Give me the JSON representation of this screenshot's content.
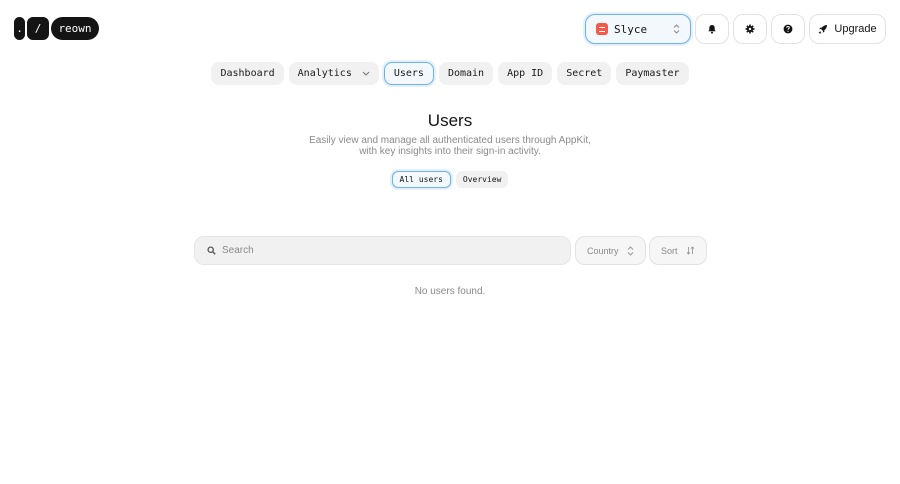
{
  "logo": {
    "part1": ".",
    "part2": "/",
    "part3": "reown"
  },
  "header": {
    "project": {
      "name": "Slyce",
      "accent": "#f25a4a"
    },
    "upgrade_label": "Upgrade",
    "icons": [
      "bell-icon",
      "gear-icon",
      "help-icon",
      "rocket-icon"
    ]
  },
  "tabs": [
    {
      "label": "Dashboard",
      "active": false
    },
    {
      "label": "Analytics",
      "active": false,
      "dropdown": true
    },
    {
      "label": "Users",
      "active": true
    },
    {
      "label": "Domain",
      "active": false
    },
    {
      "label": "App ID",
      "active": false
    },
    {
      "label": "Secret",
      "active": false
    },
    {
      "label": "Paymaster",
      "active": false
    }
  ],
  "page": {
    "title": "Users",
    "subtitle": "Easily view and manage all authenticated users through AppKit, with key insights into their sign-in activity."
  },
  "subtabs": [
    {
      "label": "All users",
      "active": true
    },
    {
      "label": "Overview",
      "active": false
    }
  ],
  "search": {
    "placeholder": "Search",
    "value": ""
  },
  "filters": {
    "country_label": "Country",
    "sort_label": "Sort"
  },
  "empty_state": "No users found.",
  "colors": {
    "accent_border": "#6fb1e8",
    "accent_bg": "#f3f8fd"
  }
}
